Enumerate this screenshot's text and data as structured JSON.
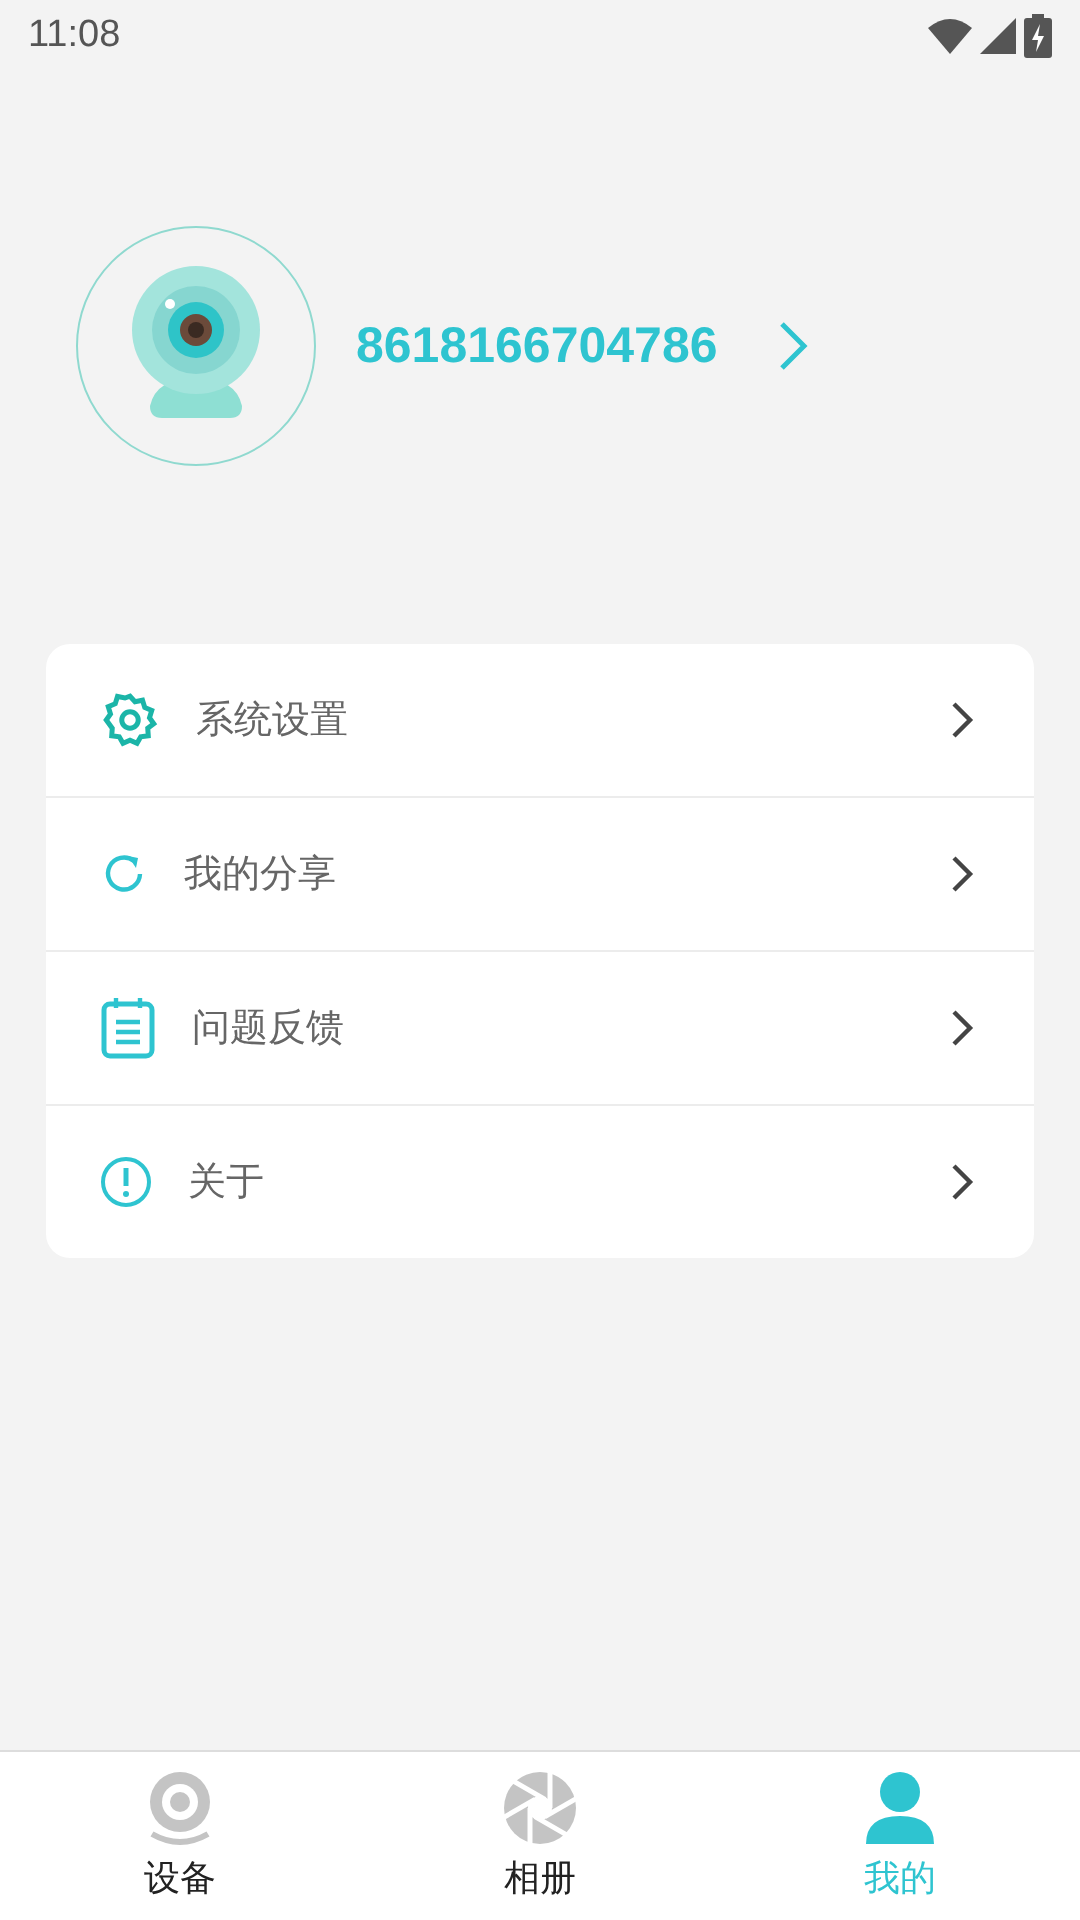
{
  "status_bar": {
    "time": "11:08"
  },
  "profile": {
    "account": "8618166704786"
  },
  "menu": [
    {
      "kind": "settings",
      "label": "系统设置"
    },
    {
      "kind": "share",
      "label": "我的分享"
    },
    {
      "kind": "feedback",
      "label": "问题反馈"
    },
    {
      "kind": "about",
      "label": "关于"
    }
  ],
  "tabs": [
    {
      "kind": "device",
      "label": "设备",
      "selected": false
    },
    {
      "kind": "album",
      "label": "相册",
      "selected": false
    },
    {
      "kind": "me",
      "label": "我的",
      "selected": true
    }
  ]
}
